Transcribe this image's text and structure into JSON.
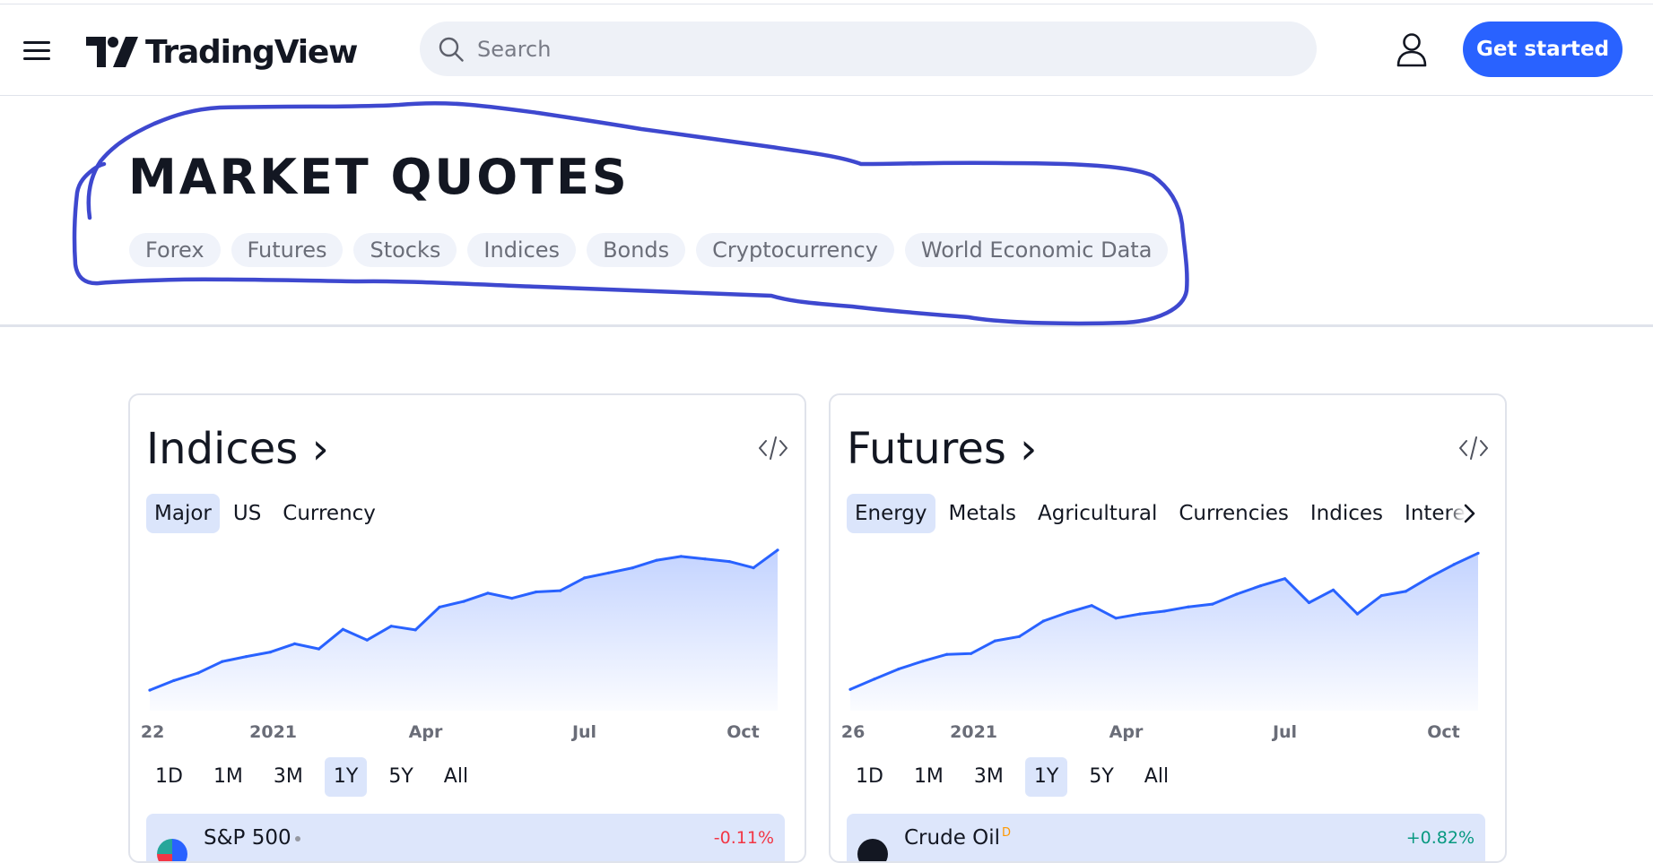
{
  "header": {
    "logo_text": "TradingView",
    "search_placeholder": "Search",
    "cta_label": "Get started"
  },
  "page": {
    "title": "MARKET QUOTES",
    "chips": [
      "Forex",
      "Futures",
      "Stocks",
      "Indices",
      "Bonds",
      "Cryptocurrency",
      "World Economic Data"
    ]
  },
  "colors": {
    "accent": "#2962ff",
    "active_tab_bg": "#dbe5fb",
    "annotation": "#3e48cf",
    "negative": "#f23645",
    "positive": "#089981"
  },
  "cards": [
    {
      "title": "Indices ›",
      "tabs": [
        "Major",
        "US",
        "Currency"
      ],
      "active_tab": "Major",
      "ranges": [
        "1D",
        "1M",
        "3M",
        "1Y",
        "5Y",
        "All"
      ],
      "active_range": "1Y",
      "row": {
        "name": "S&P 500",
        "sup": "",
        "change": "-0.11%",
        "change_color": "#f23645",
        "icon": "sp500-logo-icon"
      },
      "chart_data": {
        "type": "area",
        "title": "",
        "x_tick_labels": [
          "22",
          "2021",
          "Apr",
          "Jul",
          "Oct"
        ],
        "x": [
          "2020-10-22",
          "2020-11-05",
          "2020-11-19",
          "2020-12-03",
          "2020-12-17",
          "2020-12-31",
          "2021-01-14",
          "2021-01-28",
          "2021-02-11",
          "2021-02-25",
          "2021-03-11",
          "2021-03-25",
          "2021-04-08",
          "2021-04-22",
          "2021-05-06",
          "2021-05-20",
          "2021-06-03",
          "2021-06-17",
          "2021-07-01",
          "2021-07-15",
          "2021-07-29",
          "2021-08-12",
          "2021-08-26",
          "2021-09-09",
          "2021-09-23",
          "2021-10-07",
          "2021-10-21"
        ],
        "values": [
          3435,
          3510,
          3570,
          3660,
          3700,
          3735,
          3800,
          3760,
          3915,
          3830,
          3940,
          3910,
          4090,
          4135,
          4200,
          4160,
          4210,
          4220,
          4320,
          4360,
          4400,
          4460,
          4490,
          4470,
          4450,
          4400,
          4540
        ],
        "ylim": [
          3400,
          4560
        ],
        "grid": false,
        "legend": "none"
      }
    },
    {
      "title": "Futures ›",
      "tabs": [
        "Energy",
        "Metals",
        "Agricultural",
        "Currencies",
        "Indices",
        "Interest Rates"
      ],
      "active_tab": "Energy",
      "ranges": [
        "1D",
        "1M",
        "3M",
        "1Y",
        "5Y",
        "All"
      ],
      "active_range": "1Y",
      "row": {
        "name": "Crude Oil",
        "sup": "D",
        "change": "+0.82%",
        "change_color": "#089981",
        "icon": "crude-oil-logo-icon"
      },
      "chart_data": {
        "type": "area",
        "title": "",
        "x_tick_labels": [
          "26",
          "2021",
          "Apr",
          "Jul",
          "Oct"
        ],
        "x": [
          "2020-10-26",
          "2020-11-09",
          "2020-11-23",
          "2020-12-07",
          "2020-12-21",
          "2021-01-04",
          "2021-01-18",
          "2021-02-01",
          "2021-02-15",
          "2021-03-01",
          "2021-03-15",
          "2021-03-29",
          "2021-04-12",
          "2021-04-26",
          "2021-05-10",
          "2021-05-24",
          "2021-06-07",
          "2021-06-21",
          "2021-07-05",
          "2021-07-19",
          "2021-08-02",
          "2021-08-16",
          "2021-08-30",
          "2021-09-13",
          "2021-09-27",
          "2021-10-11",
          "2021-10-25"
        ],
        "values": [
          35.8,
          39.5,
          43.0,
          45.8,
          48.2,
          48.5,
          53.0,
          54.5,
          60.0,
          63.0,
          65.5,
          61.0,
          62.5,
          63.5,
          65.0,
          66.0,
          69.5,
          72.5,
          75.0,
          66.5,
          71.0,
          62.5,
          69.0,
          70.5,
          75.5,
          80.0,
          84.0
        ],
        "ylim": [
          34,
          86
        ],
        "grid": false,
        "legend": "none"
      }
    }
  ]
}
